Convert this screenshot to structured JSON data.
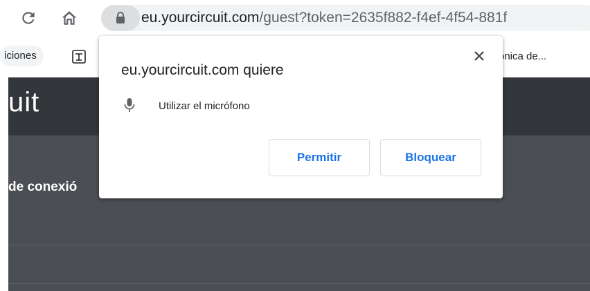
{
  "browser": {
    "url_host": "eu.yourcircuit.com",
    "url_path": "/guest?token=2635f882-f4ef-4f54-881f"
  },
  "bookmarks": {
    "item1": "iciones",
    "item2": "ónica de..."
  },
  "page": {
    "logo_fragment": "uit",
    "connection_text": "de conexió"
  },
  "dialog": {
    "title": "eu.yourcircuit.com quiere",
    "permission": "Utilizar el micrófono",
    "allow_label": "Permitir",
    "block_label": "Bloquear",
    "close_symbol": "✕"
  },
  "colors": {
    "accent": "#1a73e8",
    "header_bg": "#33363a",
    "body_bg": "#4b4e53"
  }
}
